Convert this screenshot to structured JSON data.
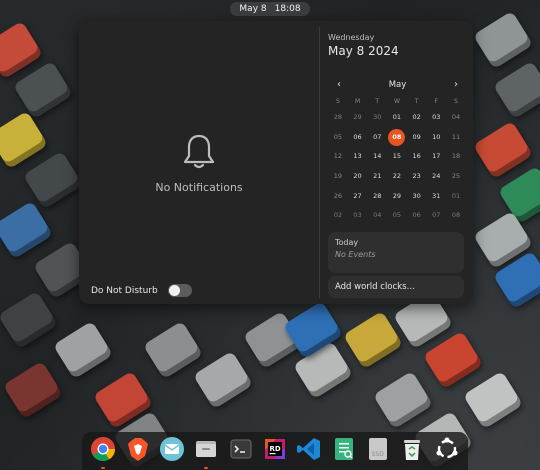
{
  "topbar": {
    "date": "May 8",
    "time": "18:08"
  },
  "notifications": {
    "empty_text": "No Notifications",
    "dnd_label": "Do Not Disturb",
    "dnd_on": false
  },
  "calendar": {
    "day_name": "Wednesday",
    "full_date": "May 8 2024",
    "month": "May",
    "weekday_headers": [
      "S",
      "M",
      "T",
      "W",
      "T",
      "F",
      "S"
    ],
    "weeks": [
      [
        "28",
        "29",
        "30",
        "01",
        "02",
        "03",
        "04"
      ],
      [
        "05",
        "06",
        "07",
        "08",
        "09",
        "10",
        "11"
      ],
      [
        "12",
        "13",
        "14",
        "15",
        "16",
        "17",
        "18"
      ],
      [
        "19",
        "20",
        "21",
        "22",
        "23",
        "24",
        "25"
      ],
      [
        "26",
        "27",
        "28",
        "29",
        "30",
        "31",
        "01"
      ],
      [
        "02",
        "03",
        "04",
        "05",
        "06",
        "07",
        "08"
      ]
    ],
    "today": "08",
    "events_title": "Today",
    "events_text": "No Events",
    "world_clocks": "Add world clocks…"
  },
  "accent": "#e95420",
  "dock": [
    {
      "name": "chrome-icon",
      "running": true
    },
    {
      "name": "brave-icon",
      "running": false
    },
    {
      "name": "mail-icon",
      "running": false
    },
    {
      "name": "files-icon",
      "running": true
    },
    {
      "name": "terminal-icon",
      "running": false
    },
    {
      "name": "rider-icon",
      "running": false
    },
    {
      "name": "vscode-icon",
      "running": false
    },
    {
      "name": "text-editor-icon",
      "running": false
    },
    {
      "name": "ssd-drive-icon",
      "running": false
    },
    {
      "name": "trash-icon",
      "running": false
    },
    {
      "name": "ubuntu-apps-icon",
      "running": false
    }
  ]
}
